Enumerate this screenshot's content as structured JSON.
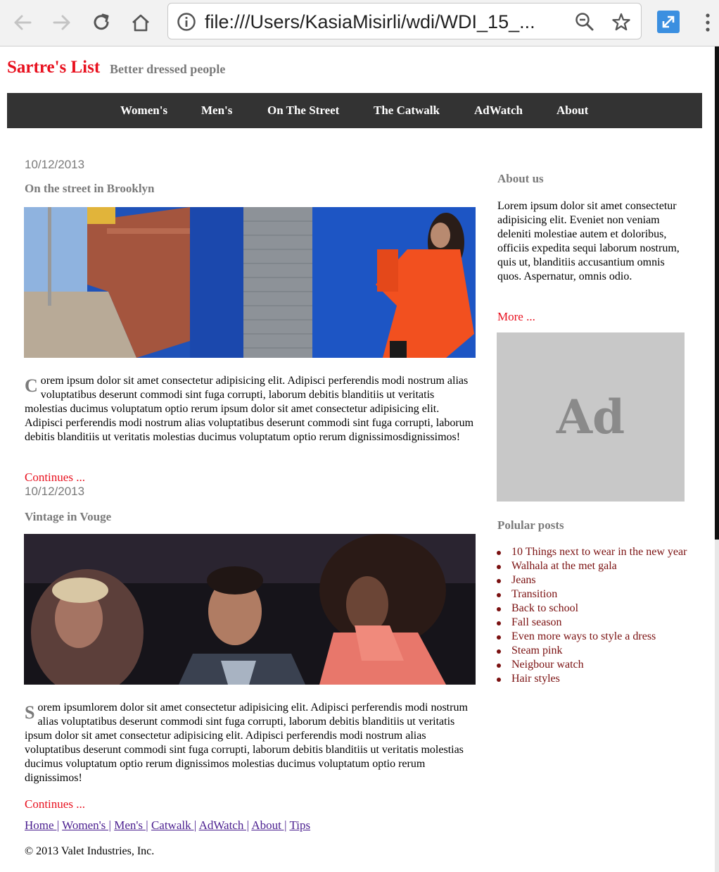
{
  "browser": {
    "url": "file:///Users/KasiaMisirli/wdi/WDI_15_...",
    "icons": [
      "back-arrow-icon",
      "forward-arrow-icon",
      "reload-icon",
      "home-icon",
      "info-icon",
      "zoom-icon",
      "star-icon",
      "extension-icon",
      "menu-icon"
    ]
  },
  "site": {
    "title": "Sartre's List",
    "tagline": "Better dressed people"
  },
  "nav": [
    "Women's",
    "Men's",
    "On The Street",
    "The Catwalk",
    "AdWatch",
    "About"
  ],
  "posts": [
    {
      "date": "10/12/2013",
      "title": "On the street in Brooklyn",
      "dropcap": "C",
      "body": "orem ipsum dolor sit amet consectetur adipisicing elit. Adipisci perferendis modi nostrum alias voluptatibus deserunt commodi sint fuga corrupti, laborum debitis blanditiis ut veritatis molestias ducimus voluptatum optio rerum ipsum dolor sit amet consectetur adipisicing elit. Adipisci perferendis modi nostrum alias voluptatibus deserunt commodi sint fuga corrupti, laborum debitis blanditiis ut veritatis molestias ducimus voluptatum optio rerum dignissimosdignissimos!",
      "continue": "Continues ..."
    },
    {
      "date": "10/12/2013",
      "title": "Vintage in Vouge",
      "dropcap": "S",
      "body": "orem ipsumlorem dolor sit amet consectetur adipisicing elit. Adipisci perferendis modi nostrum alias voluptatibus deserunt commodi sint fuga corrupti, laborum debitis blanditiis ut veritatis ipsum dolor sit amet consectetur adipisicing elit. Adipisci perferendis modi nostrum alias voluptatibus deserunt commodi sint fuga corrupti, laborum debitis blanditiis ut veritatis molestias ducimus voluptatum optio rerum dignissimos molestias ducimus voluptatum optio rerum dignissimos!",
      "continue": "Continues ..."
    }
  ],
  "sidebar": {
    "about_heading": "About us",
    "about_text": "Lorem ipsum dolor sit amet consectetur adipisicing elit. Eveniet non veniam deleniti molestiae autem et doloribus, officiis expedita sequi laborum nostrum, quis ut, blanditiis accusantium omnis quos. Aspernatur, omnis odio.",
    "more": "More ...",
    "ad_label": "Ad",
    "popular_heading": "Polular posts",
    "popular": [
      "10 Things next to wear in the new year",
      "Walhala at the met gala",
      "Jeans",
      "Transition",
      "Back to school",
      "Fall season",
      "Even more ways to style a dress",
      "Steam pink",
      "Neigbour watch",
      "Hair styles"
    ]
  },
  "footer": {
    "links": [
      "Home |",
      "Women's |",
      "Men's |",
      "Catwalk |",
      "AdWatch |",
      "About |",
      "Tips"
    ],
    "copyright": "© 2013 Valet Industries, Inc."
  },
  "colors": {
    "brand_red": "#e8101e",
    "nav_bg": "#333333",
    "muted_gray": "#7a7a7a",
    "popular_link": "#7a1010",
    "footer_link": "#4a1e8f"
  }
}
